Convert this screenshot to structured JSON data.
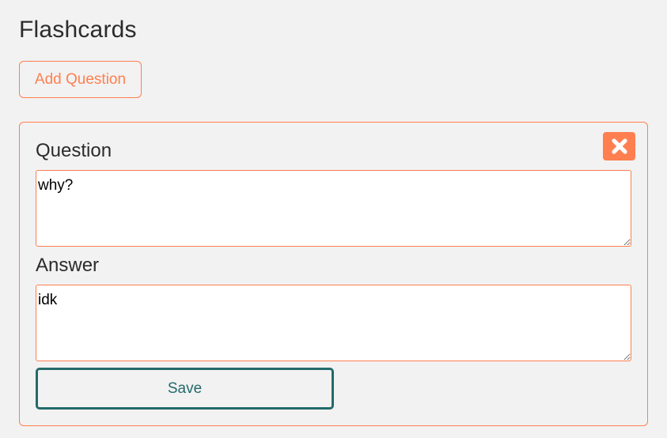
{
  "app": {
    "title": "Flashcards"
  },
  "toolbar": {
    "add_label": "Add Question"
  },
  "card": {
    "question_label": "Question",
    "question_value": "why?",
    "answer_label": "Answer",
    "answer_value": "idk",
    "save_label": "Save",
    "close_icon": "close-icon"
  },
  "colors": {
    "accent": "#ff7f50",
    "save_border": "#246a6a",
    "background": "#f2f2f2",
    "text": "#2b2b2b"
  }
}
